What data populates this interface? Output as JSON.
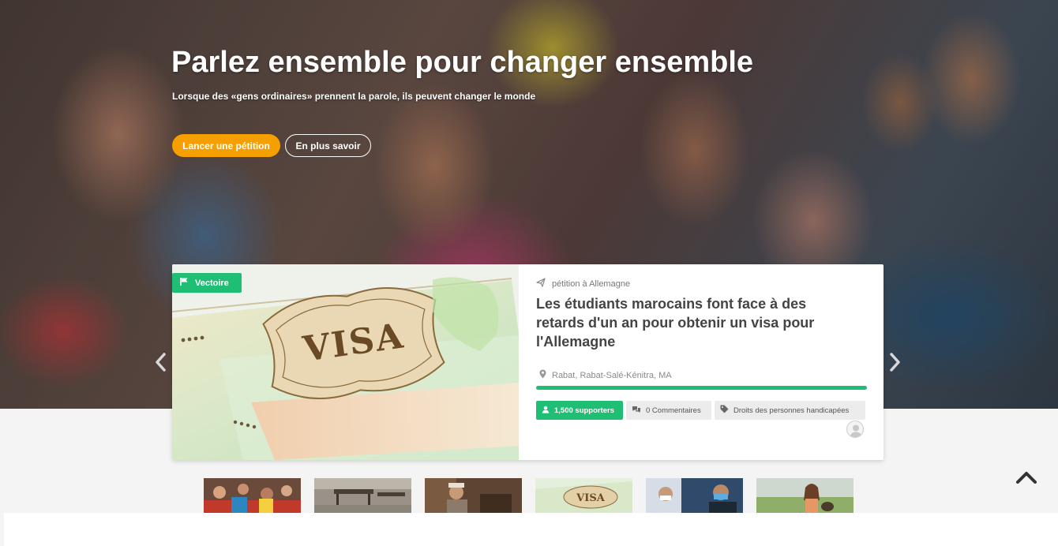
{
  "hero": {
    "title": "Parlez ensemble pour changer ensemble",
    "subtitle": "Lorsque des «gens ordinaires» prennent la parole, ils peuvent changer le monde",
    "primary_button": "Lancer une pétition",
    "secondary_button": "En plus savoir"
  },
  "featured_petition": {
    "badge": "Vectoire",
    "badge_icon": "flag-icon",
    "image_text": "VISA",
    "target_label": "pétition à Allemagne",
    "target_icon": "paper-plane-icon",
    "title": "Les étudiants marocains font face à des retards d'un an pour obtenir un visa pour l'Allemagne",
    "location": "Rabat, Rabat-Salé-Kénitra, MA",
    "location_icon": "map-pin-icon",
    "progress_percent": 100,
    "supporters": "1,500 supporters",
    "comments": "0 Commentaires",
    "category": "Droits des personnes handicapées",
    "accent_color": "#1ebe74"
  },
  "carousel": {
    "prev_icon": "chevron-left-icon",
    "next_icon": "chevron-right-icon",
    "thumbnails": [
      {
        "name": "protest-crowd"
      },
      {
        "name": "classroom-desks"
      },
      {
        "name": "elderly-man"
      },
      {
        "name": "visa-document"
      },
      {
        "name": "masked-people"
      },
      {
        "name": "girl-with-dog"
      }
    ]
  },
  "colors": {
    "brand_orange": "#f5a000",
    "success_green": "#1ebe74"
  }
}
